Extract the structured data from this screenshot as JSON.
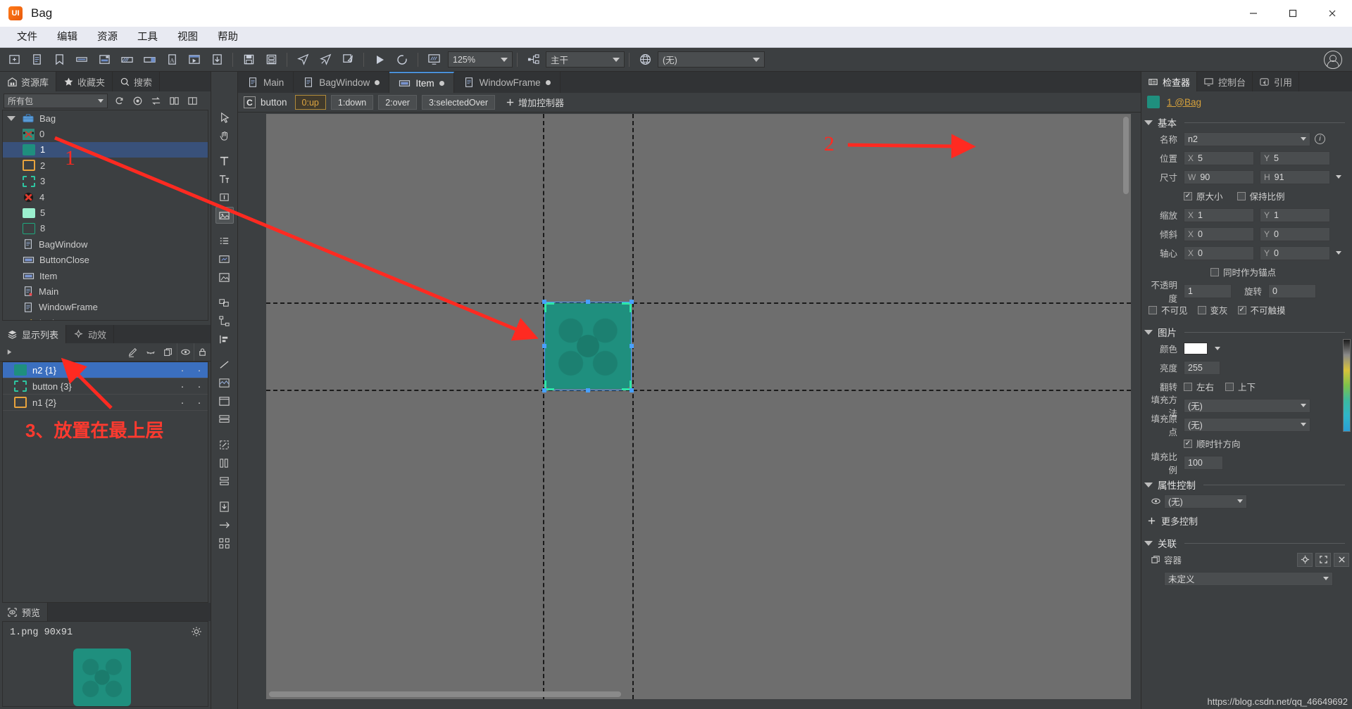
{
  "window": {
    "app_icon": "ui-logo-icon",
    "title": "Bag",
    "buttons": {
      "minimize": "–",
      "maximize": "□",
      "close": "✕"
    }
  },
  "menubar": {
    "items": [
      {
        "label": "文件",
        "name": "menu-file"
      },
      {
        "label": "编辑",
        "name": "menu-edit"
      },
      {
        "label": "资源",
        "name": "menu-resource"
      },
      {
        "label": "工具",
        "name": "menu-tools"
      },
      {
        "label": "视图",
        "name": "menu-view"
      },
      {
        "label": "帮助",
        "name": "menu-help"
      }
    ]
  },
  "toolbar": {
    "zoom": "125%",
    "branch": "主干",
    "locale": "(无)",
    "icons": [
      "new-folder-icon",
      "new-document-icon",
      "bookmark-icon",
      "new-label-icon",
      "new-group-icon",
      "new-progressbar-icon",
      "new-slider-icon",
      "new-font-icon",
      "new-movieclip-icon",
      "import-icon",
      "save-icon",
      "save-all-icon",
      "publish-icon",
      "publish-all-icon",
      "publish-settings-icon",
      "run-icon",
      "refresh-icon",
      "preview-icon",
      "branch-icon",
      "globe-icon"
    ]
  },
  "library": {
    "tabs": [
      {
        "label": "资源库",
        "icon": "library-icon",
        "active": true
      },
      {
        "label": "收藏夹",
        "icon": "star-icon",
        "active": false
      },
      {
        "label": "搜索",
        "icon": "search-icon",
        "active": false
      }
    ],
    "filter": "所有包",
    "filter_icons": [
      "refresh-icon",
      "target-icon",
      "sort-icon",
      "split-view-icon",
      "grid-view-icon"
    ],
    "tree": [
      {
        "label": "Bag",
        "icon": "package-icon",
        "depth": 0,
        "expanded": true,
        "selected": false
      },
      {
        "label": "0",
        "icon": "image-swatch",
        "depth": 1,
        "selected": false,
        "color": "#2f8a78"
      },
      {
        "label": "1",
        "icon": "image-swatch",
        "depth": 1,
        "selected": true,
        "color": "#1f8f7e"
      },
      {
        "label": "2",
        "icon": "rect-orange-icon",
        "depth": 1,
        "selected": false,
        "color": "#e8a33d"
      },
      {
        "label": "3",
        "icon": "rect-dashed-icon",
        "depth": 1,
        "selected": false,
        "color": "#2ec4a0"
      },
      {
        "label": "4",
        "icon": "close-badge-icon",
        "depth": 1,
        "selected": false,
        "color": "#d93a2b"
      },
      {
        "label": "5",
        "icon": "rect-mint-icon",
        "depth": 1,
        "selected": false,
        "color": "#9bf0cf"
      },
      {
        "label": "8",
        "icon": "rect-green-icon",
        "depth": 1,
        "selected": false,
        "color": "#1fa87e"
      },
      {
        "label": "BagWindow",
        "icon": "component-icon",
        "depth": 1,
        "selected": false
      },
      {
        "label": "ButtonClose",
        "icon": "button-icon",
        "depth": 1,
        "selected": false
      },
      {
        "label": "Item",
        "icon": "button-icon",
        "depth": 1,
        "selected": false
      },
      {
        "label": "Main",
        "icon": "component-modified-icon",
        "depth": 1,
        "selected": false
      },
      {
        "label": "WindowFrame",
        "icon": "component-icon",
        "depth": 1,
        "selected": false
      },
      {
        "label": "btnimage",
        "icon": "sprite-icon",
        "depth": 1,
        "selected": false
      }
    ]
  },
  "displaylist": {
    "tabs": [
      {
        "label": "显示列表",
        "icon": "layers-icon",
        "active": true
      },
      {
        "label": "动效",
        "icon": "sparkle-icon",
        "active": false
      }
    ],
    "toolbar_icons": [
      "expand-icon",
      "pencil-icon",
      "hide-icon",
      "duplicate-icon",
      "eye-icon",
      "lock-icon"
    ],
    "rows": [
      {
        "label": "n2 {1}",
        "icon": "image-swatch",
        "color": "#1f8f7e",
        "selected": true,
        "eye": "·",
        "lock": "·"
      },
      {
        "label": "button {3}",
        "icon": "rect-dashed-icon",
        "color": "#2ec4a0",
        "selected": false,
        "eye": "·",
        "lock": "·"
      },
      {
        "label": "n1 {2}",
        "icon": "rect-orange-icon",
        "color": "#e8a33d",
        "selected": false,
        "eye": "·",
        "lock": "·"
      }
    ]
  },
  "preview": {
    "tab": {
      "label": "预览",
      "icon": "preview-eye-icon"
    },
    "info": "1.png  90x91",
    "gear_icon": "gear-icon"
  },
  "vtools": [
    "pointer-icon",
    "hand-icon",
    "text-icon",
    "richtext-icon",
    "input-icon",
    "image-icon",
    "list-icon",
    "loader-icon",
    "component-icon",
    "group-icon",
    "relation-icon",
    "align-icon",
    "line-icon",
    "graph-icon",
    "frame-icon",
    "stack-icon",
    "scale-icon",
    "column-icon",
    "row-icon",
    "import-down-icon",
    "export-icon",
    "tile-icon"
  ],
  "doctabs": [
    {
      "label": "Main",
      "icon": "component-icon",
      "modified": false,
      "active": false
    },
    {
      "label": "BagWindow",
      "icon": "component-icon",
      "modified": true,
      "active": false
    },
    {
      "label": "Item",
      "icon": "button-icon",
      "modified": true,
      "active": true
    },
    {
      "label": "WindowFrame",
      "icon": "component-icon",
      "modified": true,
      "active": false
    }
  ],
  "controller": {
    "badge": "C",
    "name": "button",
    "states": [
      {
        "label": "0:up",
        "active": true
      },
      {
        "label": "1:down",
        "active": false
      },
      {
        "label": "2:over",
        "active": false
      },
      {
        "label": "3:selectedOver",
        "active": false
      }
    ],
    "add_label": "增加控制器",
    "add_icon": "plus-icon"
  },
  "inspector": {
    "tabs": [
      {
        "label": "检查器",
        "icon": "inspector-icon",
        "active": true
      },
      {
        "label": "控制台",
        "icon": "console-icon",
        "active": false
      },
      {
        "label": "引用",
        "icon": "reference-icon",
        "active": false
      }
    ],
    "object": {
      "swatch_color": "#1f8f7e",
      "link": "1 @Bag"
    },
    "sections": {
      "basic": {
        "title": "基本",
        "name_label": "名称",
        "name_value": "n2",
        "info_icon": "info-icon",
        "pos_label": "位置",
        "pos_x_prefix": "X",
        "pos_x": "5",
        "pos_y_prefix": "Y",
        "pos_y": "5",
        "size_label": "尺寸",
        "size_w_prefix": "W",
        "size_w": "90",
        "size_h_prefix": "H",
        "size_h": "91",
        "orig_size_label": "原大小",
        "orig_size_checked": true,
        "keep_ratio_label": "保持比例",
        "keep_ratio_checked": false,
        "scale_label": "缩放",
        "scale_x": "1",
        "scale_y": "1",
        "skew_label": "倾斜",
        "skew_x": "0",
        "skew_y": "0",
        "pivot_label": "轴心",
        "pivot_x": "0",
        "pivot_y": "0",
        "anchor_label": "同时作为锚点",
        "anchor_checked": false,
        "opacity_label": "不透明度",
        "opacity": "1",
        "rotation_label": "旋转",
        "rotation": "0",
        "invisible_label": "不可见",
        "invisible_checked": false,
        "gray_label": "变灰",
        "gray_checked": false,
        "untouchable_label": "不可触摸",
        "untouchable_checked": true
      },
      "image": {
        "title": "图片",
        "color_label": "颜色",
        "color_value": "#ffffff",
        "brightness_label": "亮度",
        "brightness": "255",
        "flip_label": "翻转",
        "flip_h_label": "左右",
        "flip_h_checked": false,
        "flip_v_label": "上下",
        "flip_v_checked": false,
        "fill_method_label": "填充方法",
        "fill_method": "(无)",
        "fill_origin_label": "填充原点",
        "fill_origin": "(无)",
        "clockwise_label": "顺时针方向",
        "clockwise_checked": true,
        "fill_amount_label": "填充比例",
        "fill_amount": "100"
      },
      "property_control": {
        "title": "属性控制",
        "eye_icon": "eye-icon",
        "value": "(无)",
        "more_label": "更多控制",
        "more_icon": "plus-icon"
      },
      "relation": {
        "title": "关联",
        "container_label": "容器",
        "container_icon": "container-icon",
        "value": "未定义",
        "buttons": [
          "target-icon",
          "fullscreen-icon",
          "close-icon"
        ]
      }
    }
  },
  "annotations": [
    {
      "id": "a1",
      "text": "1",
      "type": "number"
    },
    {
      "id": "a2",
      "text": "2",
      "type": "number"
    },
    {
      "id": "a3",
      "text": "3、放置在最上层",
      "type": "text"
    }
  ],
  "watermark": "https://blog.csdn.net/qq_46649692"
}
